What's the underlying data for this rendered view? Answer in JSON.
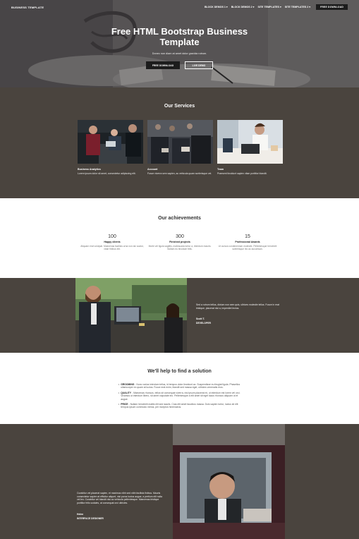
{
  "nav": {
    "brand": "BUSINESS TEMPLATE",
    "items": [
      "BLOCK DEMOS 1",
      "BLOCK DEMOS 2",
      "SITE TEMPLATES",
      "SITE TEMPLATES 2"
    ],
    "cta": "FREE DOWNLOAD"
  },
  "hero": {
    "title_line1": "Free HTML Bootstrap Business",
    "title_line2": "Template",
    "subtitle": "Donec non diam at amet dolor gravida rutrum.",
    "primary_button": "FREE DOWNLOAD",
    "secondary_button": "LIVE DEMO"
  },
  "services": {
    "title": "Our Services",
    "items": [
      {
        "name": "Business Analytics",
        "desc": "Lorem ipsum dolor sit amet, consectetur adipiscing elit."
      },
      {
        "name": "Account",
        "desc": "Fusce viverra sem sapien, ac vehicula quam scelerisque vel."
      },
      {
        "name": "Team",
        "desc": "Praesent tincidunt sapien vitae porttitor blandit."
      }
    ]
  },
  "achievements": {
    "title": "Our achievements",
    "stats": [
      {
        "num": "100",
        "label": "Happy clients",
        "desc": "Aliquam erat volutpat. Maecenas facilisis urna non dui auctor, vitae finibus elit."
      },
      {
        "num": "300",
        "label": "Finished projects",
        "desc": "Morbi vel ligula sagittis, malesuada tortor a, interdum mauris. Nullam eu tincidunt felis."
      },
      {
        "num": "15",
        "label": "Professional Awards",
        "desc": "Ut cursus condimentum molestie. Pellentesque hendrerit scelerisque leo ac accumsan."
      }
    ]
  },
  "testimonial1": {
    "quote": "Sed a rutrum tellus, dictum non sem quis, ultrices molestie tellus. Fusce in erat tristique, placerat nisi a, imperdiet lectus.",
    "name": "Scott T.",
    "role": "DEVELOPER"
  },
  "solution": {
    "title": "We'll help to find a solution",
    "items": [
      {
        "key": "GROOMING",
        "text": " - Nunc varius interdum tellus, id tempus dolor tincidunt ac. Suspendisse eu feugiat ligula. Phasellus ullamcorper ex quam at luctus. Fusce erat enim, blandit sed massa eget, ultricies venenatis eros."
      },
      {
        "key": "QUALITY",
        "text": " - Maecenas rhoncus, tellus sit consequat viverra, nisi ipsum placerat mi, ut interdum est lorem vel orci. Vivamus ut interdum libero, sit amet vulputate leo. Pellentesque a elit amet sit eget lacus rhoncus aliquam ut et augue."
      },
      {
        "key": "PRICE",
        "text": " - Nullam hendrerit mattis elit sed iaculis. Cras elit amet faucibus massa. Duis sapien tortor, luctus sit elit tempus ipsum commodo metus, per inceptos himenaeos."
      }
    ]
  },
  "testimonial2": {
    "quote": "Curabitur vel placerat sapien, et maximus nibh sed nibh facilisis finibus. Mauris consectetur sapien at efficitur aliquet, nisi purus luctus augue, a pretium elit nulla vel leo. Curabitur vel blandit nisi ac vehicula pellentesque. Maecenas tristique porttitor felis sodales, at consequat orci ultricies.",
    "name": "Helen",
    "role": "INTERFACE DESIGNER"
  },
  "colors": {
    "dark_bg": "#4a443e",
    "button_dark": "#1c1c1c",
    "white": "#ffffff"
  }
}
